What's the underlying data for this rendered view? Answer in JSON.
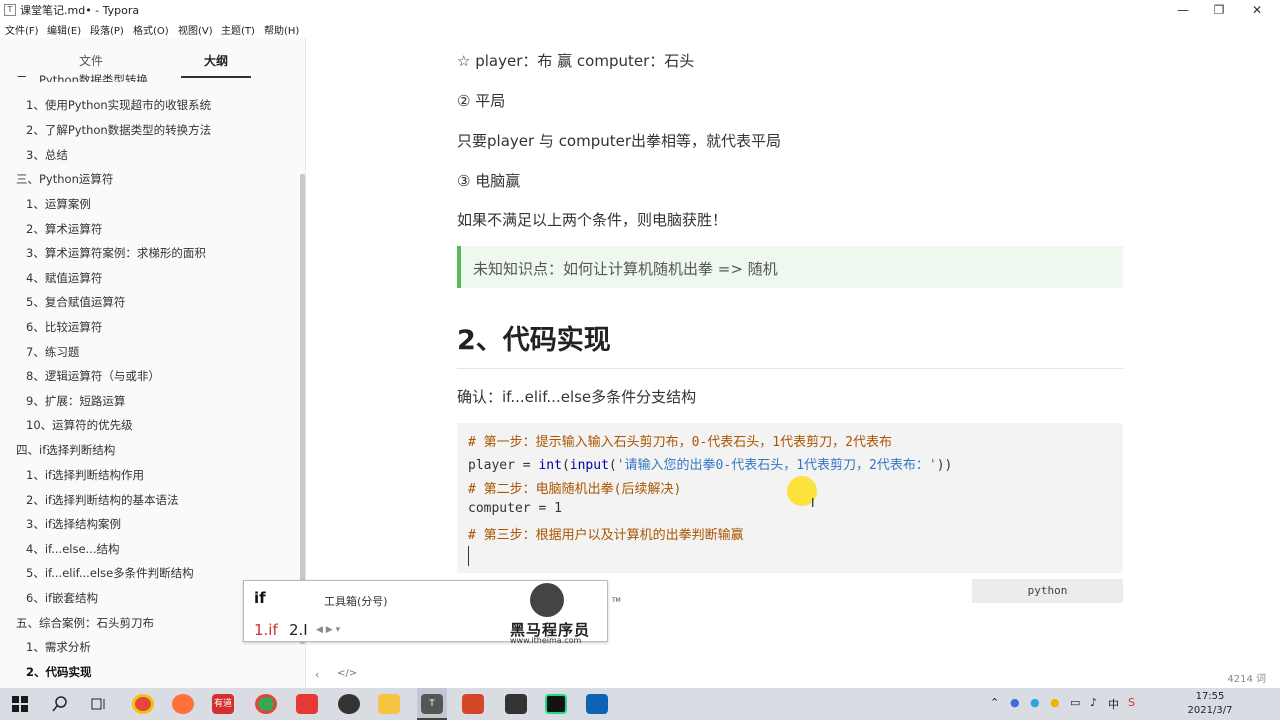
{
  "window": {
    "title": "课堂笔记.md• - Typora",
    "app_icon": "T",
    "controls": {
      "minimize": "—",
      "maximize": "❐",
      "close": "✕"
    }
  },
  "menubar": [
    "文件(F)",
    "编辑(E)",
    "段落(P)",
    "格式(O)",
    "视图(V)",
    "主题(T)",
    "帮助(H)"
  ],
  "sidebar": {
    "tabs": {
      "files": "文件",
      "outline": "大纲"
    },
    "outline": [
      "二、Python数据类型转换",
      "1、使用Python实现超市的收银系统",
      "2、了解Python数据类型的转换方法",
      "3、总结",
      "三、Python运算符",
      "1、运算案例",
      "2、算术运算符",
      "3、算术运算符案例：求梯形的面积",
      "4、赋值运算符",
      "5、复合赋值运算符",
      "6、比较运算符",
      "7、练习题",
      "8、逻辑运算符（与或非）",
      "9、扩展：短路运算",
      "10、运算符的优先级",
      "四、if选择判断结构",
      "1、if选择判断结构作用",
      "2、if选择判断结构的基本语法",
      "3、if选择结构案例",
      "4、if...else...结构",
      "5、if...elif...else多条件判断结构",
      "6、if嵌套结构",
      "五、综合案例：石头剪刀布",
      "1、需求分析",
      "2、代码实现"
    ]
  },
  "content": {
    "line1": "☆ player：布     赢 computer：石头",
    "line2": "② 平局",
    "line3": "只要player 与 computer出拳相等，就代表平局",
    "line4": "③ 电脑赢",
    "line5": "如果不满足以上两个条件，则电脑获胜！",
    "quote": "未知知识点：如何让计算机随机出拳 => 随机",
    "heading": "2、代码实现",
    "confirm": "确认：if...elif...else多条件分支结构",
    "code": {
      "c1": "# 第一步：提示输入输入石头剪刀布，0-代表石头，1代表剪刀，2代表布",
      "c2_var": "player = ",
      "c2_fn1": "int",
      "c2_paren1": "(",
      "c2_fn2": "input",
      "c2_paren2": "(",
      "c2_str": "'请输入您的出拳0-代表石头，1代表剪刀，2代表布：'",
      "c2_close": "))",
      "c3": "# 第二步：电脑随机出拳(后续解决)",
      "c4": "computer = 1",
      "c5": "# 第三步：根据用户以及计算机的出拳判断输赢"
    },
    "lang": "python"
  },
  "ime": {
    "typed": "if",
    "toolbox": "工具箱(分号)",
    "candidate1": "1.if",
    "candidate2": "2.I",
    "arrows": "◀ ▶ ▾"
  },
  "watermark": {
    "tm": "TM",
    "name": "黑马程序员",
    "url": "www.itheima.com"
  },
  "statusbar": {
    "back": "‹",
    "source": "</>",
    "word_count": "4214 词"
  },
  "taskbar": {
    "icons": [
      "windows-start",
      "search",
      "task-view",
      "chrome",
      "firefox",
      "youdao",
      "chrome-alt",
      "app-red",
      "app-circle",
      "explorer",
      "typora",
      "powerpoint",
      "recorder",
      "pycharm",
      "vscode"
    ],
    "youdao_label": "有道",
    "tray_text": "中",
    "time": "17:55",
    "date": "2021/3/7"
  },
  "colors": {
    "quote_border": "#5cb85c",
    "quote_bg": "#eef8ee",
    "code_comment": "#aa5500",
    "code_builtin": "#0000aa",
    "code_string": "#3477c5"
  }
}
